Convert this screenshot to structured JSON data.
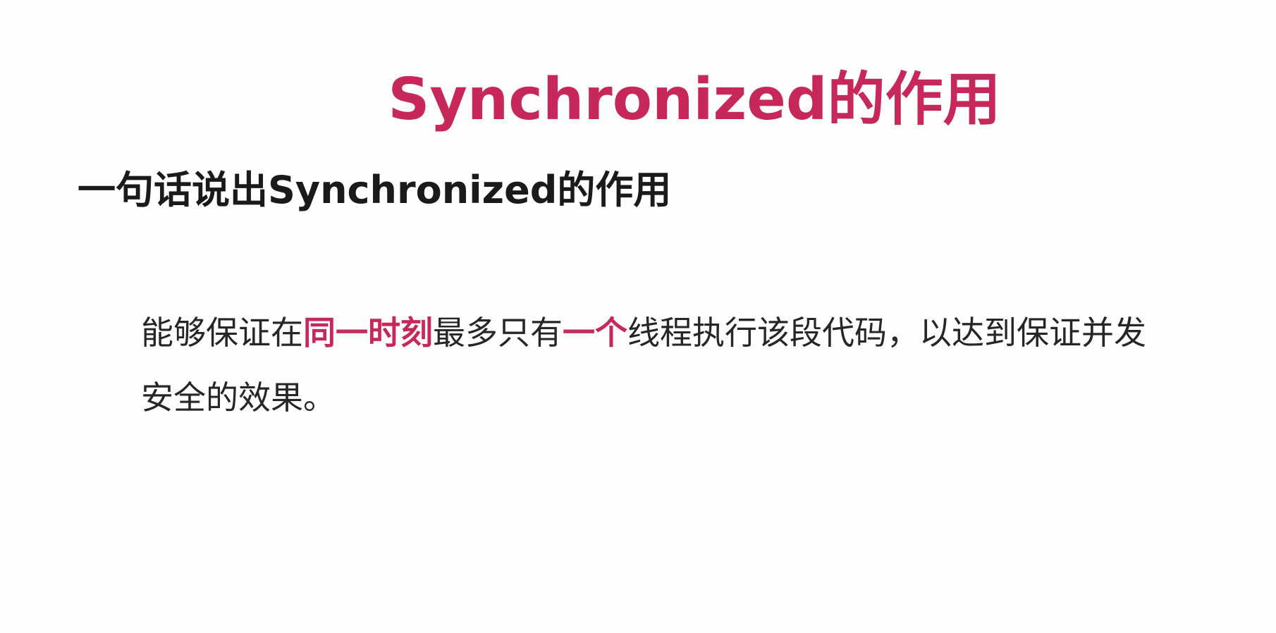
{
  "slide": {
    "title": "Synchronized的作用",
    "subtitle": "一句话说出Synchronized的作用",
    "body": {
      "part1": "能够保证在",
      "highlight1": "同一时刻",
      "part2": "最多只有",
      "highlight2": "一个",
      "part3": "线程执行该段代码，以达到保证并发安全的效果。"
    }
  },
  "colors": {
    "accent": "#c7285a",
    "text": "#262626",
    "heading": "#1a1a1a",
    "background": "#fefefe"
  }
}
